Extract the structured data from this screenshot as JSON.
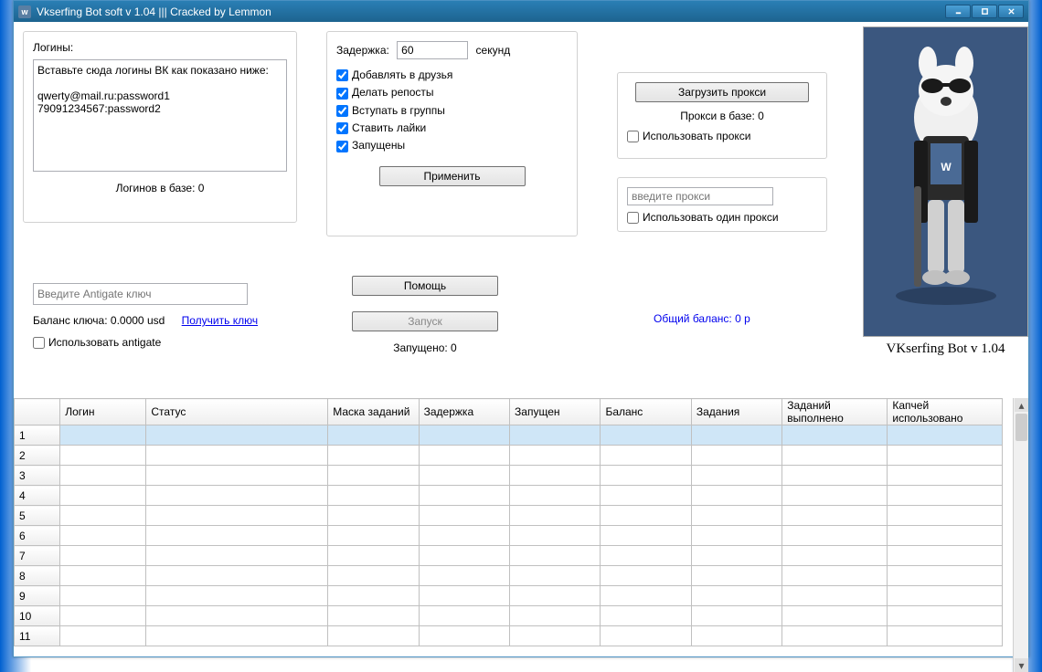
{
  "window": {
    "title": "Vkserfing Bot soft  v 1.04 ||| Cracked by Lemmon"
  },
  "logins": {
    "label": "Логины:",
    "placeholder_text": "Вставьте сюда логины ВК как показано ниже:\n\nqwerty@mail.ru:password1\n79091234567:password2",
    "count_label": "Логинов в базе:  0"
  },
  "settings": {
    "delay_label": "Задержка:",
    "delay_value": "60",
    "delay_units": "секунд",
    "cb_addfriends": "Добавлять в друзья",
    "cb_repost": "Делать репосты",
    "cb_groups": "Вступать в группы",
    "cb_likes": "Ставить лайки",
    "cb_running": "Запущены",
    "apply_btn": "Применить"
  },
  "proxy": {
    "load_btn": "Загрузить прокси",
    "count_label": "Прокси в базе:   0",
    "use_proxy": "Использовать прокси",
    "input_placeholder": "введите прокси",
    "use_single": "Использовать один прокси"
  },
  "antigate": {
    "input_placeholder": "Введите Antigate ключ",
    "balance_label": "Баланс ключа:  0.0000 usd",
    "get_key": "Получить ключ",
    "use_antigate": "Использовать antigate"
  },
  "actions": {
    "help_btn": "Помощь",
    "run_btn": "Запуск",
    "running_label": "Запущено:  0",
    "total_balance": "Общий баланс:  0 р"
  },
  "version_text": "VKserfing Bot v 1.04",
  "table": {
    "headers": [
      "Логин",
      "Статус",
      "Маска заданий",
      "Задержка",
      "Запущен",
      "Баланс",
      "Задания",
      "Заданий выполнено",
      "Капчей использовано"
    ],
    "row_count": 11
  }
}
